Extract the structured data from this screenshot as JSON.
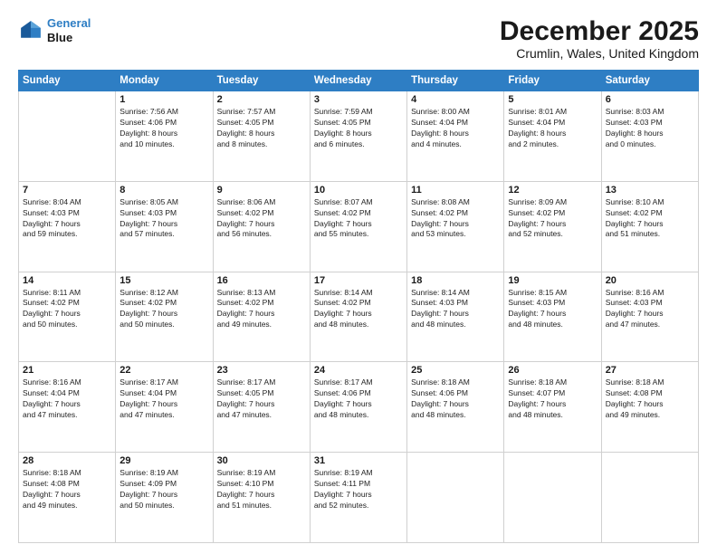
{
  "header": {
    "logo_line1": "General",
    "logo_line2": "Blue",
    "title": "December 2025",
    "subtitle": "Crumlin, Wales, United Kingdom"
  },
  "weekdays": [
    "Sunday",
    "Monday",
    "Tuesday",
    "Wednesday",
    "Thursday",
    "Friday",
    "Saturday"
  ],
  "weeks": [
    [
      {
        "day": "",
        "info": ""
      },
      {
        "day": "1",
        "info": "Sunrise: 7:56 AM\nSunset: 4:06 PM\nDaylight: 8 hours\nand 10 minutes."
      },
      {
        "day": "2",
        "info": "Sunrise: 7:57 AM\nSunset: 4:05 PM\nDaylight: 8 hours\nand 8 minutes."
      },
      {
        "day": "3",
        "info": "Sunrise: 7:59 AM\nSunset: 4:05 PM\nDaylight: 8 hours\nand 6 minutes."
      },
      {
        "day": "4",
        "info": "Sunrise: 8:00 AM\nSunset: 4:04 PM\nDaylight: 8 hours\nand 4 minutes."
      },
      {
        "day": "5",
        "info": "Sunrise: 8:01 AM\nSunset: 4:04 PM\nDaylight: 8 hours\nand 2 minutes."
      },
      {
        "day": "6",
        "info": "Sunrise: 8:03 AM\nSunset: 4:03 PM\nDaylight: 8 hours\nand 0 minutes."
      }
    ],
    [
      {
        "day": "7",
        "info": "Sunrise: 8:04 AM\nSunset: 4:03 PM\nDaylight: 7 hours\nand 59 minutes."
      },
      {
        "day": "8",
        "info": "Sunrise: 8:05 AM\nSunset: 4:03 PM\nDaylight: 7 hours\nand 57 minutes."
      },
      {
        "day": "9",
        "info": "Sunrise: 8:06 AM\nSunset: 4:02 PM\nDaylight: 7 hours\nand 56 minutes."
      },
      {
        "day": "10",
        "info": "Sunrise: 8:07 AM\nSunset: 4:02 PM\nDaylight: 7 hours\nand 55 minutes."
      },
      {
        "day": "11",
        "info": "Sunrise: 8:08 AM\nSunset: 4:02 PM\nDaylight: 7 hours\nand 53 minutes."
      },
      {
        "day": "12",
        "info": "Sunrise: 8:09 AM\nSunset: 4:02 PM\nDaylight: 7 hours\nand 52 minutes."
      },
      {
        "day": "13",
        "info": "Sunrise: 8:10 AM\nSunset: 4:02 PM\nDaylight: 7 hours\nand 51 minutes."
      }
    ],
    [
      {
        "day": "14",
        "info": "Sunrise: 8:11 AM\nSunset: 4:02 PM\nDaylight: 7 hours\nand 50 minutes."
      },
      {
        "day": "15",
        "info": "Sunrise: 8:12 AM\nSunset: 4:02 PM\nDaylight: 7 hours\nand 50 minutes."
      },
      {
        "day": "16",
        "info": "Sunrise: 8:13 AM\nSunset: 4:02 PM\nDaylight: 7 hours\nand 49 minutes."
      },
      {
        "day": "17",
        "info": "Sunrise: 8:14 AM\nSunset: 4:02 PM\nDaylight: 7 hours\nand 48 minutes."
      },
      {
        "day": "18",
        "info": "Sunrise: 8:14 AM\nSunset: 4:03 PM\nDaylight: 7 hours\nand 48 minutes."
      },
      {
        "day": "19",
        "info": "Sunrise: 8:15 AM\nSunset: 4:03 PM\nDaylight: 7 hours\nand 48 minutes."
      },
      {
        "day": "20",
        "info": "Sunrise: 8:16 AM\nSunset: 4:03 PM\nDaylight: 7 hours\nand 47 minutes."
      }
    ],
    [
      {
        "day": "21",
        "info": "Sunrise: 8:16 AM\nSunset: 4:04 PM\nDaylight: 7 hours\nand 47 minutes."
      },
      {
        "day": "22",
        "info": "Sunrise: 8:17 AM\nSunset: 4:04 PM\nDaylight: 7 hours\nand 47 minutes."
      },
      {
        "day": "23",
        "info": "Sunrise: 8:17 AM\nSunset: 4:05 PM\nDaylight: 7 hours\nand 47 minutes."
      },
      {
        "day": "24",
        "info": "Sunrise: 8:17 AM\nSunset: 4:06 PM\nDaylight: 7 hours\nand 48 minutes."
      },
      {
        "day": "25",
        "info": "Sunrise: 8:18 AM\nSunset: 4:06 PM\nDaylight: 7 hours\nand 48 minutes."
      },
      {
        "day": "26",
        "info": "Sunrise: 8:18 AM\nSunset: 4:07 PM\nDaylight: 7 hours\nand 48 minutes."
      },
      {
        "day": "27",
        "info": "Sunrise: 8:18 AM\nSunset: 4:08 PM\nDaylight: 7 hours\nand 49 minutes."
      }
    ],
    [
      {
        "day": "28",
        "info": "Sunrise: 8:18 AM\nSunset: 4:08 PM\nDaylight: 7 hours\nand 49 minutes."
      },
      {
        "day": "29",
        "info": "Sunrise: 8:19 AM\nSunset: 4:09 PM\nDaylight: 7 hours\nand 50 minutes."
      },
      {
        "day": "30",
        "info": "Sunrise: 8:19 AM\nSunset: 4:10 PM\nDaylight: 7 hours\nand 51 minutes."
      },
      {
        "day": "31",
        "info": "Sunrise: 8:19 AM\nSunset: 4:11 PM\nDaylight: 7 hours\nand 52 minutes."
      },
      {
        "day": "",
        "info": ""
      },
      {
        "day": "",
        "info": ""
      },
      {
        "day": "",
        "info": ""
      }
    ]
  ]
}
